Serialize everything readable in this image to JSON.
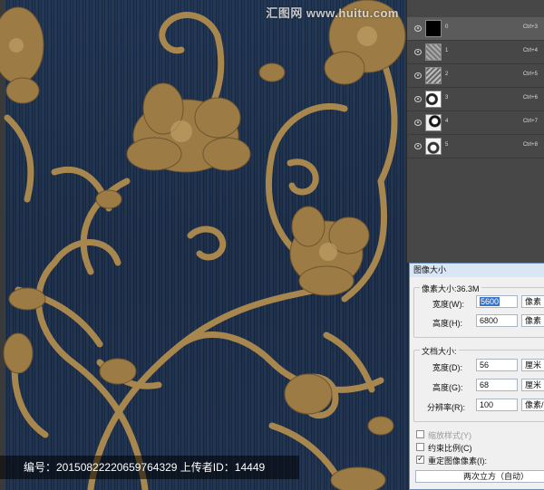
{
  "watermark": {
    "site": "汇图网 www.huitu.com"
  },
  "layers": [
    {
      "name": "0",
      "shortcut": "Ctrl+3",
      "selected": true,
      "thumb": "black"
    },
    {
      "name": "1",
      "shortcut": "Ctrl+4",
      "selected": false,
      "thumb": "noise"
    },
    {
      "name": "2",
      "shortcut": "Ctrl+5",
      "selected": false,
      "thumb": "noise"
    },
    {
      "name": "3",
      "shortcut": "Ctrl+6",
      "selected": false,
      "thumb": "pattern"
    },
    {
      "name": "4",
      "shortcut": "Ctrl+7",
      "selected": false,
      "thumb": "pattern"
    },
    {
      "name": "5",
      "shortcut": "Ctrl+8",
      "selected": false,
      "thumb": "pattern"
    }
  ],
  "dialog": {
    "title": "图像大小",
    "pixel_dimensions_label": "像素大小:36.3M",
    "width_label": "宽度(W):",
    "width_value": "5600",
    "width_unit": "像素",
    "height_label": "高度(H):",
    "height_value": "6800",
    "height_unit": "像素",
    "doc_size_label": "文档大小:",
    "doc_width_label": "宽度(D):",
    "doc_width_value": "56",
    "doc_width_unit": "厘米",
    "doc_height_label": "高度(G):",
    "doc_height_value": "68",
    "doc_height_unit": "厘米",
    "resolution_label": "分辨率(R):",
    "resolution_value": "100",
    "resolution_unit": "像素/英寸",
    "scale_styles_label": "缩放样式(Y)",
    "constrain_label": "约束比例(C)",
    "resample_label": "重定图像像素(I):",
    "resample_method": "两次立方（自动）",
    "scale_styles_checked": false,
    "constrain_checked": false,
    "resample_checked": true
  },
  "footer": {
    "text": "编号：20150822220659764329 上传者ID：14449"
  },
  "colors": {
    "background": "#1b2d45",
    "ornament": "#b08f5a",
    "panel": "#474747"
  }
}
